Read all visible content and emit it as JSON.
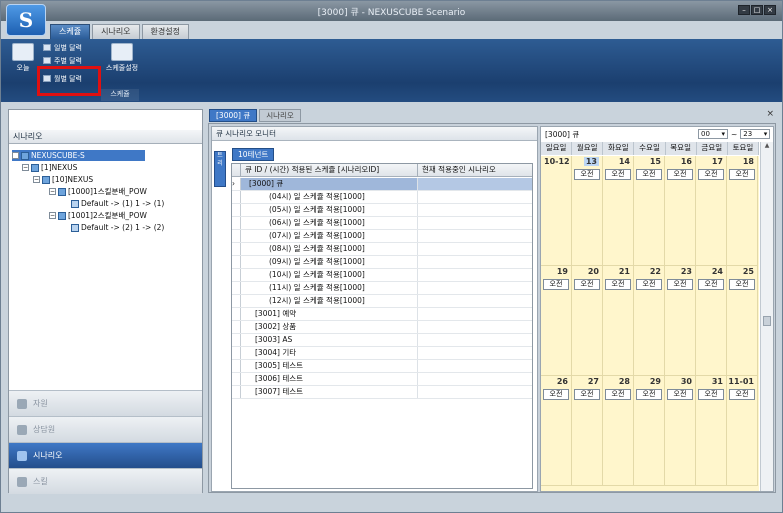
{
  "app": {
    "title": "[3000] 큐 - NEXUSCUBE Scenario",
    "logo": "S"
  },
  "menu_tabs": [
    "스케쥴",
    "시나리오",
    "환경설정"
  ],
  "ribbon": {
    "today": "오늘",
    "day_view": "일별 달력",
    "week_view": "주별 달력",
    "month_view": "월별 달력",
    "schedule_settings": "스케줄설정",
    "group_label": "스케쥴"
  },
  "left_panel": {
    "header": "시나리오",
    "tree": [
      {
        "label": "NEXUSCUBE-S"
      },
      {
        "label": "[1]NEXUS"
      },
      {
        "label": "[10]NEXUS"
      },
      {
        "label": "[1000]1스킬분배_POW"
      },
      {
        "label": "Default -> (1)  1 -> (1)"
      },
      {
        "label": "[1001]2스킬분배_POW"
      },
      {
        "label": "Default -> (2)  1 -> (2)"
      }
    ],
    "nav": [
      "자원",
      "상담원",
      "시나리오",
      "스킬"
    ]
  },
  "doc_tabs": [
    "[3000] 큐",
    "시나리오"
  ],
  "monitor": {
    "header": "큐 시나리오 모니터",
    "side_button": "트리",
    "tenant_tab": "10테넌트",
    "columns": [
      "큐 ID / (시간) 적용된 스케쥴 [시나리오ID]",
      "현재 적용중인 시나리오"
    ],
    "rows": [
      "[3000] 큐",
      "(04시) 일 스케쥴 적용[1000]",
      "(05시) 일 스케쥴 적용[1000]",
      "(06시) 일 스케쥴 적용[1000]",
      "(07시) 일 스케쥴 적용[1000]",
      "(08시) 일 스케쥴 적용[1000]",
      "(09시) 일 스케쥴 적용[1000]",
      "(10시) 일 스케쥴 적용[1000]",
      "(11시) 일 스케쥴 적용[1000]",
      "(12시) 일 스케쥴 적용[1000]",
      "[3001] 예약",
      "[3002] 상품",
      "[3003] AS",
      "[3004] 기타",
      "[3005] 테스트",
      "[3006] 테스트",
      "[3007] 테스트"
    ]
  },
  "calendar": {
    "title": "[3000] 큐",
    "hour_from": "00",
    "hour_sep": "~",
    "hour_to": "23",
    "weekdays": [
      "일요일",
      "월요일",
      "화요일",
      "수요일",
      "목요일",
      "금요일",
      "토요일"
    ],
    "weeks": [
      [
        "10-12",
        "13",
        "14",
        "15",
        "16",
        "17",
        "18"
      ],
      [
        "19",
        "20",
        "21",
        "22",
        "23",
        "24",
        "25"
      ],
      [
        "26",
        "27",
        "28",
        "29",
        "30",
        "31",
        "11-01"
      ]
    ],
    "event_label": "오전"
  }
}
